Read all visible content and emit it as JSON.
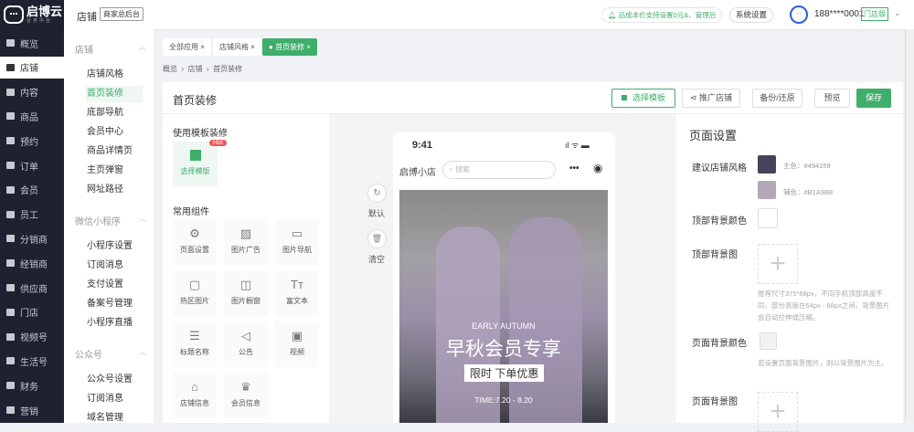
{
  "brand": {
    "name": "启博云",
    "tagline": "业务中台"
  },
  "nav": [
    "概览",
    "店铺",
    "内容",
    "商品",
    "预约",
    "订单",
    "会员",
    "员工",
    "分销商",
    "经销商",
    "供应商",
    "门店",
    "视频号",
    "生活号",
    "财务",
    "营销"
  ],
  "topbar": {
    "section": "店铺",
    "backend_button": "商家总后台",
    "notice": "品成本价支持设置0元&、管理后",
    "settings": "系统设置",
    "phone": "188****0001",
    "version_badge": "门店版"
  },
  "subnav": {
    "groups": [
      {
        "title": "店铺",
        "items": [
          "店铺风格",
          "首页装修",
          "底部导航",
          "会员中心",
          "商品详情页",
          "主页弹窗",
          "网址路径"
        ]
      },
      {
        "title": "微信小程序",
        "items": [
          "小程序设置",
          "订阅消息",
          "支付设置",
          "备案号管理",
          "小程序直播"
        ]
      },
      {
        "title": "公众号",
        "items": [
          "公众号设置",
          "订阅消息",
          "域名管理"
        ]
      }
    ]
  },
  "tabs": [
    "全部应用",
    "店铺风格",
    "首页装修"
  ],
  "breadcrumb": [
    "概览",
    "店铺",
    "首页装修"
  ],
  "page": {
    "title": "首页装修",
    "actions": {
      "template": "选择模板",
      "promote": "推广店铺",
      "backup": "备份/还原",
      "preview": "预览",
      "save": "保存"
    }
  },
  "left": {
    "template_title": "使用模板装修",
    "template_tile": "选择模版",
    "hot": "Hot",
    "components_title": "常用组件",
    "components": [
      {
        "l": "页面设置",
        "g": "⚙"
      },
      {
        "l": "图片广告",
        "g": "▨"
      },
      {
        "l": "图片导航",
        "g": "▭"
      },
      {
        "l": "热区图片",
        "g": "▢"
      },
      {
        "l": "图片橱窗",
        "g": "◫"
      },
      {
        "l": "富文本",
        "g": "Tт"
      },
      {
        "l": "标题名称",
        "g": "☰"
      },
      {
        "l": "公告",
        "g": "◁"
      },
      {
        "l": "视频",
        "g": "▣"
      },
      {
        "l": "店铺信息",
        "g": "⌂"
      },
      {
        "l": "会员信息",
        "g": "♛"
      }
    ]
  },
  "tools": {
    "reset": "默认",
    "clear": "清空"
  },
  "phone": {
    "time": "9:41",
    "store": "启博小店",
    "search_placeholder": "搜索",
    "banner": {
      "en": "EARLY AUTUMN",
      "title": "早秋会员专享",
      "tag": "限时 下单优惠",
      "time": "TIME:7.20 - 8.20"
    }
  },
  "settings": {
    "title": "页面设置",
    "style_label": "建议店铺风格",
    "primary_label": "主色：#494159",
    "secondary_label": "辅色：#B1A9B8",
    "primary": "#494159",
    "secondary": "#B1A9B8",
    "top_bg_color": "顶部背景颜色",
    "top_bg_image": "顶部背景图",
    "top_bg_hint": "推荐尺寸375*88px，不同手机顶部高度不同，部分高度在64px - 88px之间，背景图片会自动拉伸或压缩。",
    "page_bg_color": "页面背景颜色",
    "page_bg_hint": "若设置页面背景图片，则以背景图片为主。",
    "page_bg_image": "页面背景图"
  }
}
